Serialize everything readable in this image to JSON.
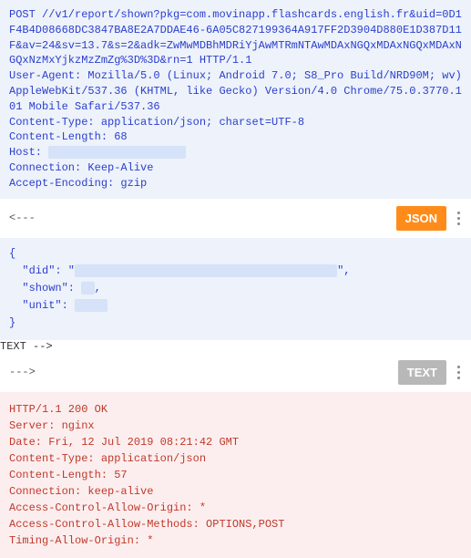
{
  "request": {
    "raw": "POST //v1/report/shown?pkg=com.movinapp.flashcards.english.fr&uid=0D1F4B4D08668DC3847BA8E2A7DDAE46-6A05C827199364A917FF2D3904D880E1D387D11F&av=24&sv=13.7&s=2&adk=ZwMwMDBhMDRiYjAwMTRmNTAwMDAxNGQxMDAxNGQxMDAxNGQxNzMxYjkzMzZmZg%3D%3D&rn=1 HTTP/1.1\nUser-Agent: Mozilla/5.0 (Linux; Android 7.0; S8_Pro Build/NRD90M; wv) AppleWebKit/537.36 (KHTML, like Gecko) Version/4.0 Chrome/75.0.3770.101 Mobile Safari/537.36\nContent-Type: application/json; charset=UTF-8\nContent-Length: 68\nHost: ",
    "tail": "\nConnection: Keep-Alive\nAccept-Encoding: gzip\n"
  },
  "sep_in": {
    "arrow": "<---",
    "badge": "JSON"
  },
  "body": {
    "open": "{",
    "did_key": "  \"did\": \"",
    "did_end": "\",",
    "shown_key": "  \"shown\": ",
    "shown_end": ",",
    "unit_key": "  \"unit\": ",
    "close": "}"
  },
  "sep_out": {
    "arrow": "--->",
    "badge": "TEXT"
  },
  "response": {
    "raw": "HTTP/1.1 200 OK\nServer: nginx\nDate: Fri, 12 Jul 2019 08:21:42 GMT\nContent-Type: application/json\nContent-Length: 57\nConnection: keep-alive\nAccess-Control-Allow-Origin: *\nAccess-Control-Allow-Methods: OPTIONS,POST\nTiming-Allow-Origin: *\n"
  }
}
